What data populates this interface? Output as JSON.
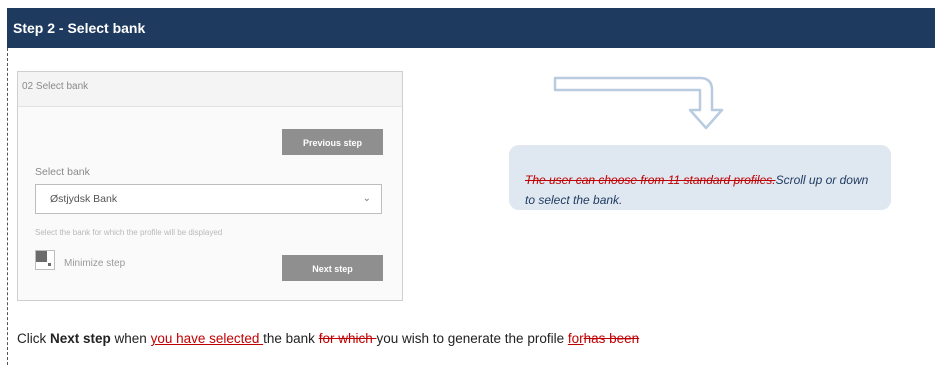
{
  "header": {
    "title": "Step 2 - Select bank"
  },
  "panel": {
    "title": "02 Select bank",
    "previous_step": "Previous step",
    "select_label": "Select bank",
    "selected_bank": "Østjydsk Bank",
    "helper_text": "Select the bank for which the profile will be displayed",
    "minimize_label": "Minimize step",
    "next_step": "Next step"
  },
  "callout": {
    "deleted_text": "The user can choose from 11 standard profiles.",
    "text": "Scroll up or down to select the bank."
  },
  "instruction": {
    "part1": "Click ",
    "bold": "Next step",
    "part2": " when ",
    "inserted1": "you have selected ",
    "part3": "the bank ",
    "deleted1": "for which ",
    "part4": "you wish to generate the profile ",
    "inserted2": "for",
    "deleted2": "has been"
  },
  "icons": {
    "minimize": "minimize-icon",
    "chevron": "chevron-down-icon",
    "arrow": "curved-arrow-icon"
  },
  "colors": {
    "header_bg": "#1f3a5f",
    "callout_bg": "#dfe7f1",
    "revision_red": "#c00000"
  }
}
